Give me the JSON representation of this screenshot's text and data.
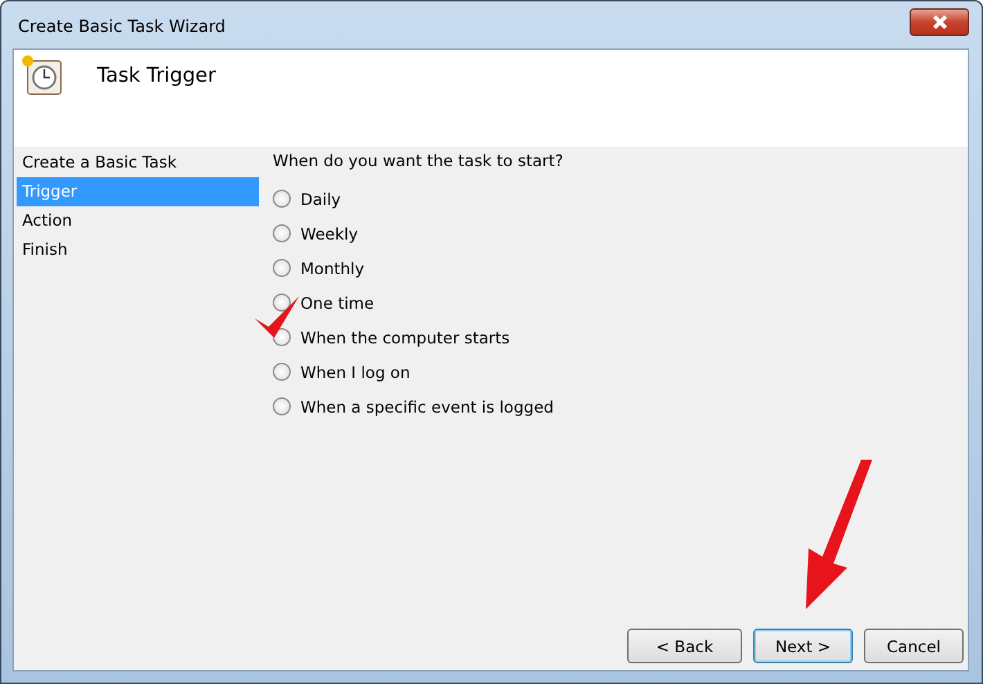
{
  "window": {
    "title": "Create Basic Task Wizard"
  },
  "header": {
    "title": "Task Trigger"
  },
  "steps": [
    {
      "label": "Create a Basic Task",
      "selected": false
    },
    {
      "label": "Trigger",
      "selected": true
    },
    {
      "label": "Action",
      "selected": false
    },
    {
      "label": "Finish",
      "selected": false
    }
  ],
  "question": "When do you want the task to start?",
  "options": [
    {
      "label": "Daily",
      "selected": false
    },
    {
      "label": "Weekly",
      "selected": false
    },
    {
      "label": "Monthly",
      "selected": false
    },
    {
      "label": "One time",
      "selected": false
    },
    {
      "label": "When the computer starts",
      "selected": false
    },
    {
      "label": "When I log on",
      "selected": false
    },
    {
      "label": "When a specific event is logged",
      "selected": false
    }
  ],
  "buttons": [
    {
      "label": "< Back",
      "kind": "normal"
    },
    {
      "label": "Next >",
      "kind": "default"
    },
    {
      "label": "Cancel",
      "kind": "normal"
    }
  ]
}
